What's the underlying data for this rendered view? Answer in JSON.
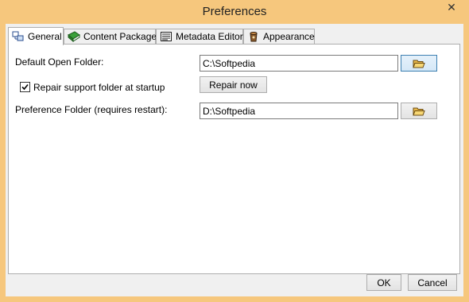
{
  "window": {
    "title": "Preferences",
    "close_glyph": "✕"
  },
  "tabs": [
    {
      "label": "General",
      "icon": "general-icon",
      "active": true
    },
    {
      "label": "Content Packager",
      "icon": "book-icon",
      "active": false
    },
    {
      "label": "Metadata Editor",
      "icon": "document-list-icon",
      "active": false
    },
    {
      "label": "Appearance",
      "icon": "paint-bucket-icon",
      "active": false
    }
  ],
  "general": {
    "default_open_folder_label": "Default Open Folder:",
    "default_open_folder_value": "C:\\Softpedia",
    "repair_checkbox_label": "Repair support folder at startup",
    "repair_checkbox_checked": true,
    "repair_now_label": "Repair now",
    "preference_folder_label": "Preference Folder (requires restart):",
    "preference_folder_value": "D:\\Softpedia"
  },
  "footer": {
    "ok_label": "OK",
    "cancel_label": "Cancel"
  },
  "colors": {
    "title_bar": "#f6c77d",
    "focus_border": "#3c7fb1"
  }
}
